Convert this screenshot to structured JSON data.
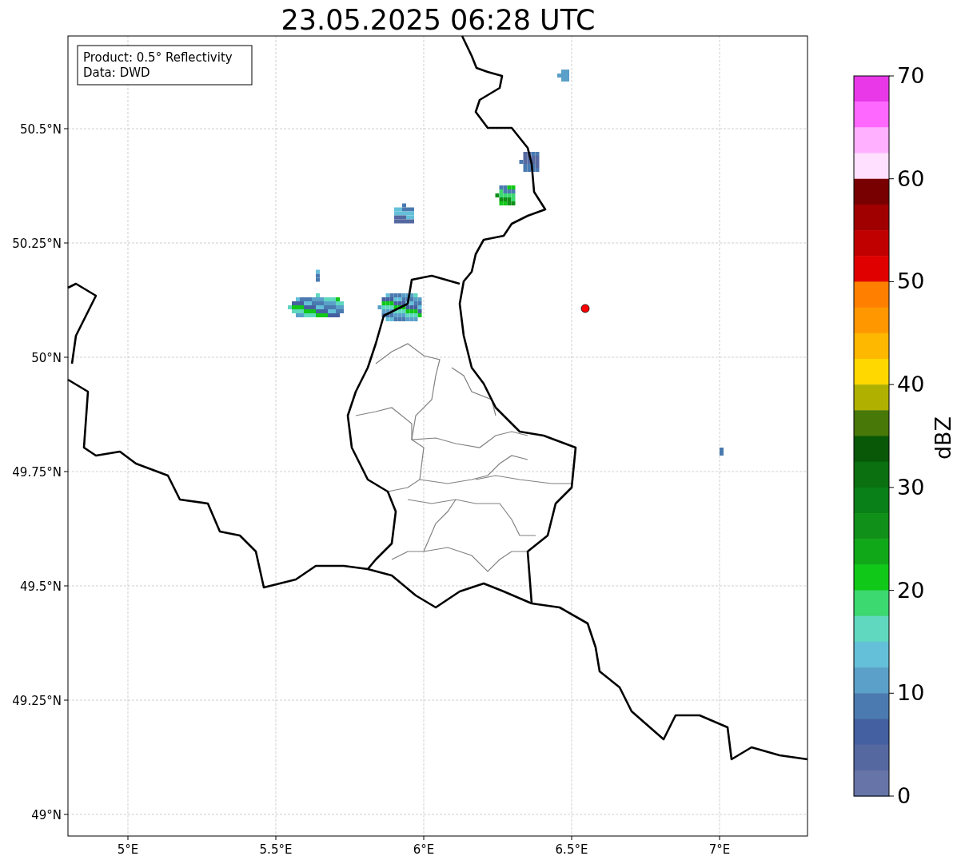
{
  "title": "23.05.2025 06:28 UTC",
  "info_box": {
    "lines": [
      "Product: 0.5° Reflectivity",
      "Data: DWD"
    ]
  },
  "lat_ticks": [
    "50.5°N",
    "50.25°N",
    "50°N",
    "49.75°N",
    "49.5°N",
    "49.25°N",
    "49°N"
  ],
  "lon_ticks": [
    "5°E",
    "5.5°E",
    "6°E",
    "6.5°E",
    "7°E"
  ],
  "colorbar": {
    "label": "dBZ",
    "ticks": [
      "70",
      "60",
      "50",
      "40",
      "30",
      "20",
      "10",
      "0"
    ],
    "bins": [
      {
        "color": "#e838e8"
      },
      {
        "color": "#ff68ff"
      },
      {
        "color": "#ffb0ff"
      },
      {
        "color": "#ffe0ff"
      },
      {
        "color": "#780000"
      },
      {
        "color": "#a00000"
      },
      {
        "color": "#c00000"
      },
      {
        "color": "#e00000"
      },
      {
        "color": "#ff8000"
      },
      {
        "color": "#ff9800"
      },
      {
        "color": "#ffb800"
      },
      {
        "color": "#ffd800"
      },
      {
        "color": "#b0b000"
      },
      {
        "color": "#487808"
      },
      {
        "color": "#085808"
      },
      {
        "color": "#0a7010"
      },
      {
        "color": "#0a8018"
      },
      {
        "color": "#109018"
      },
      {
        "color": "#10a818"
      },
      {
        "color": "#10c818"
      },
      {
        "color": "#3cd870"
      },
      {
        "color": "#60d8c0"
      },
      {
        "color": "#64c0d8"
      },
      {
        "color": "#5aa0c8"
      },
      {
        "color": "#4a7ab0"
      },
      {
        "color": "#4560a0"
      },
      {
        "color": "#5568a0"
      },
      {
        "color": "#6674a8"
      }
    ]
  }
}
